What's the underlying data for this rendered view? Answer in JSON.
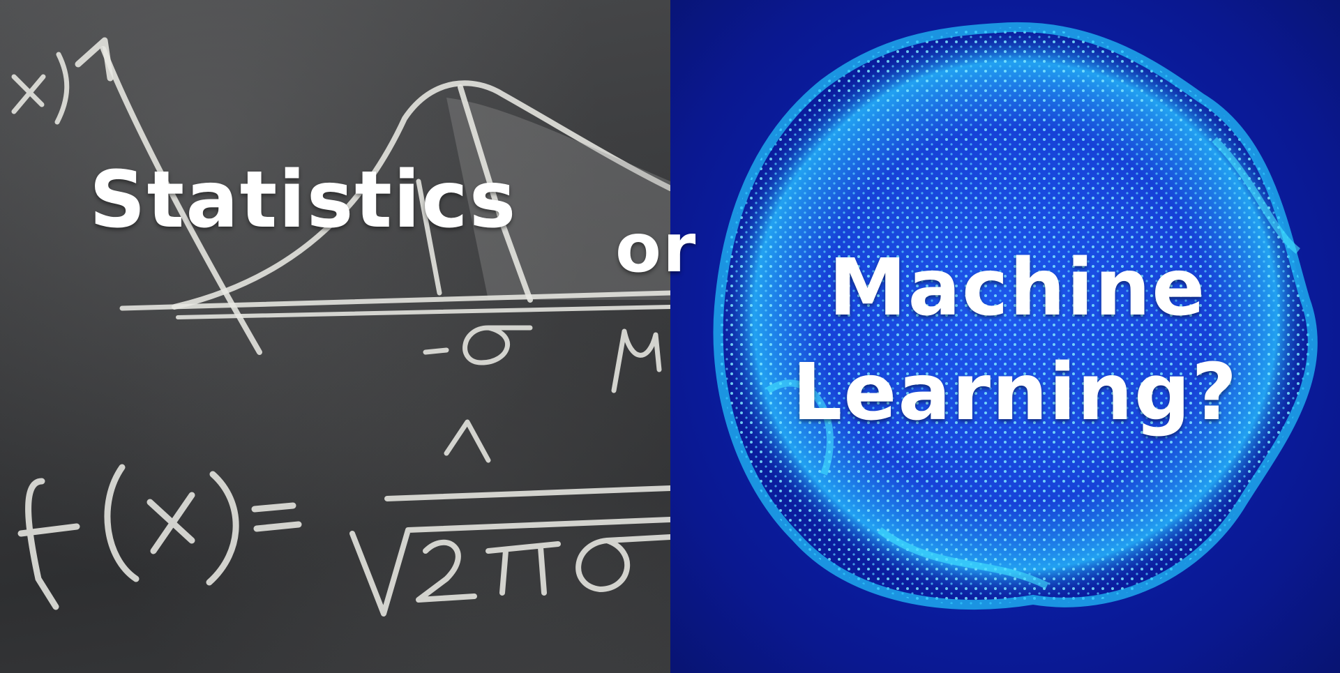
{
  "headline": {
    "left_word": "Statistics",
    "connector": "or",
    "right_line1": "Machine",
    "right_line2": "Learning?"
  },
  "chalkboard": {
    "background_color": "#3a3b3d",
    "chalk_color": "#e8e8e3"
  },
  "sphere": {
    "background_color": "#0b1fa8",
    "particle_color": "#3fe0f0",
    "edge_color": "#22c7ff"
  }
}
